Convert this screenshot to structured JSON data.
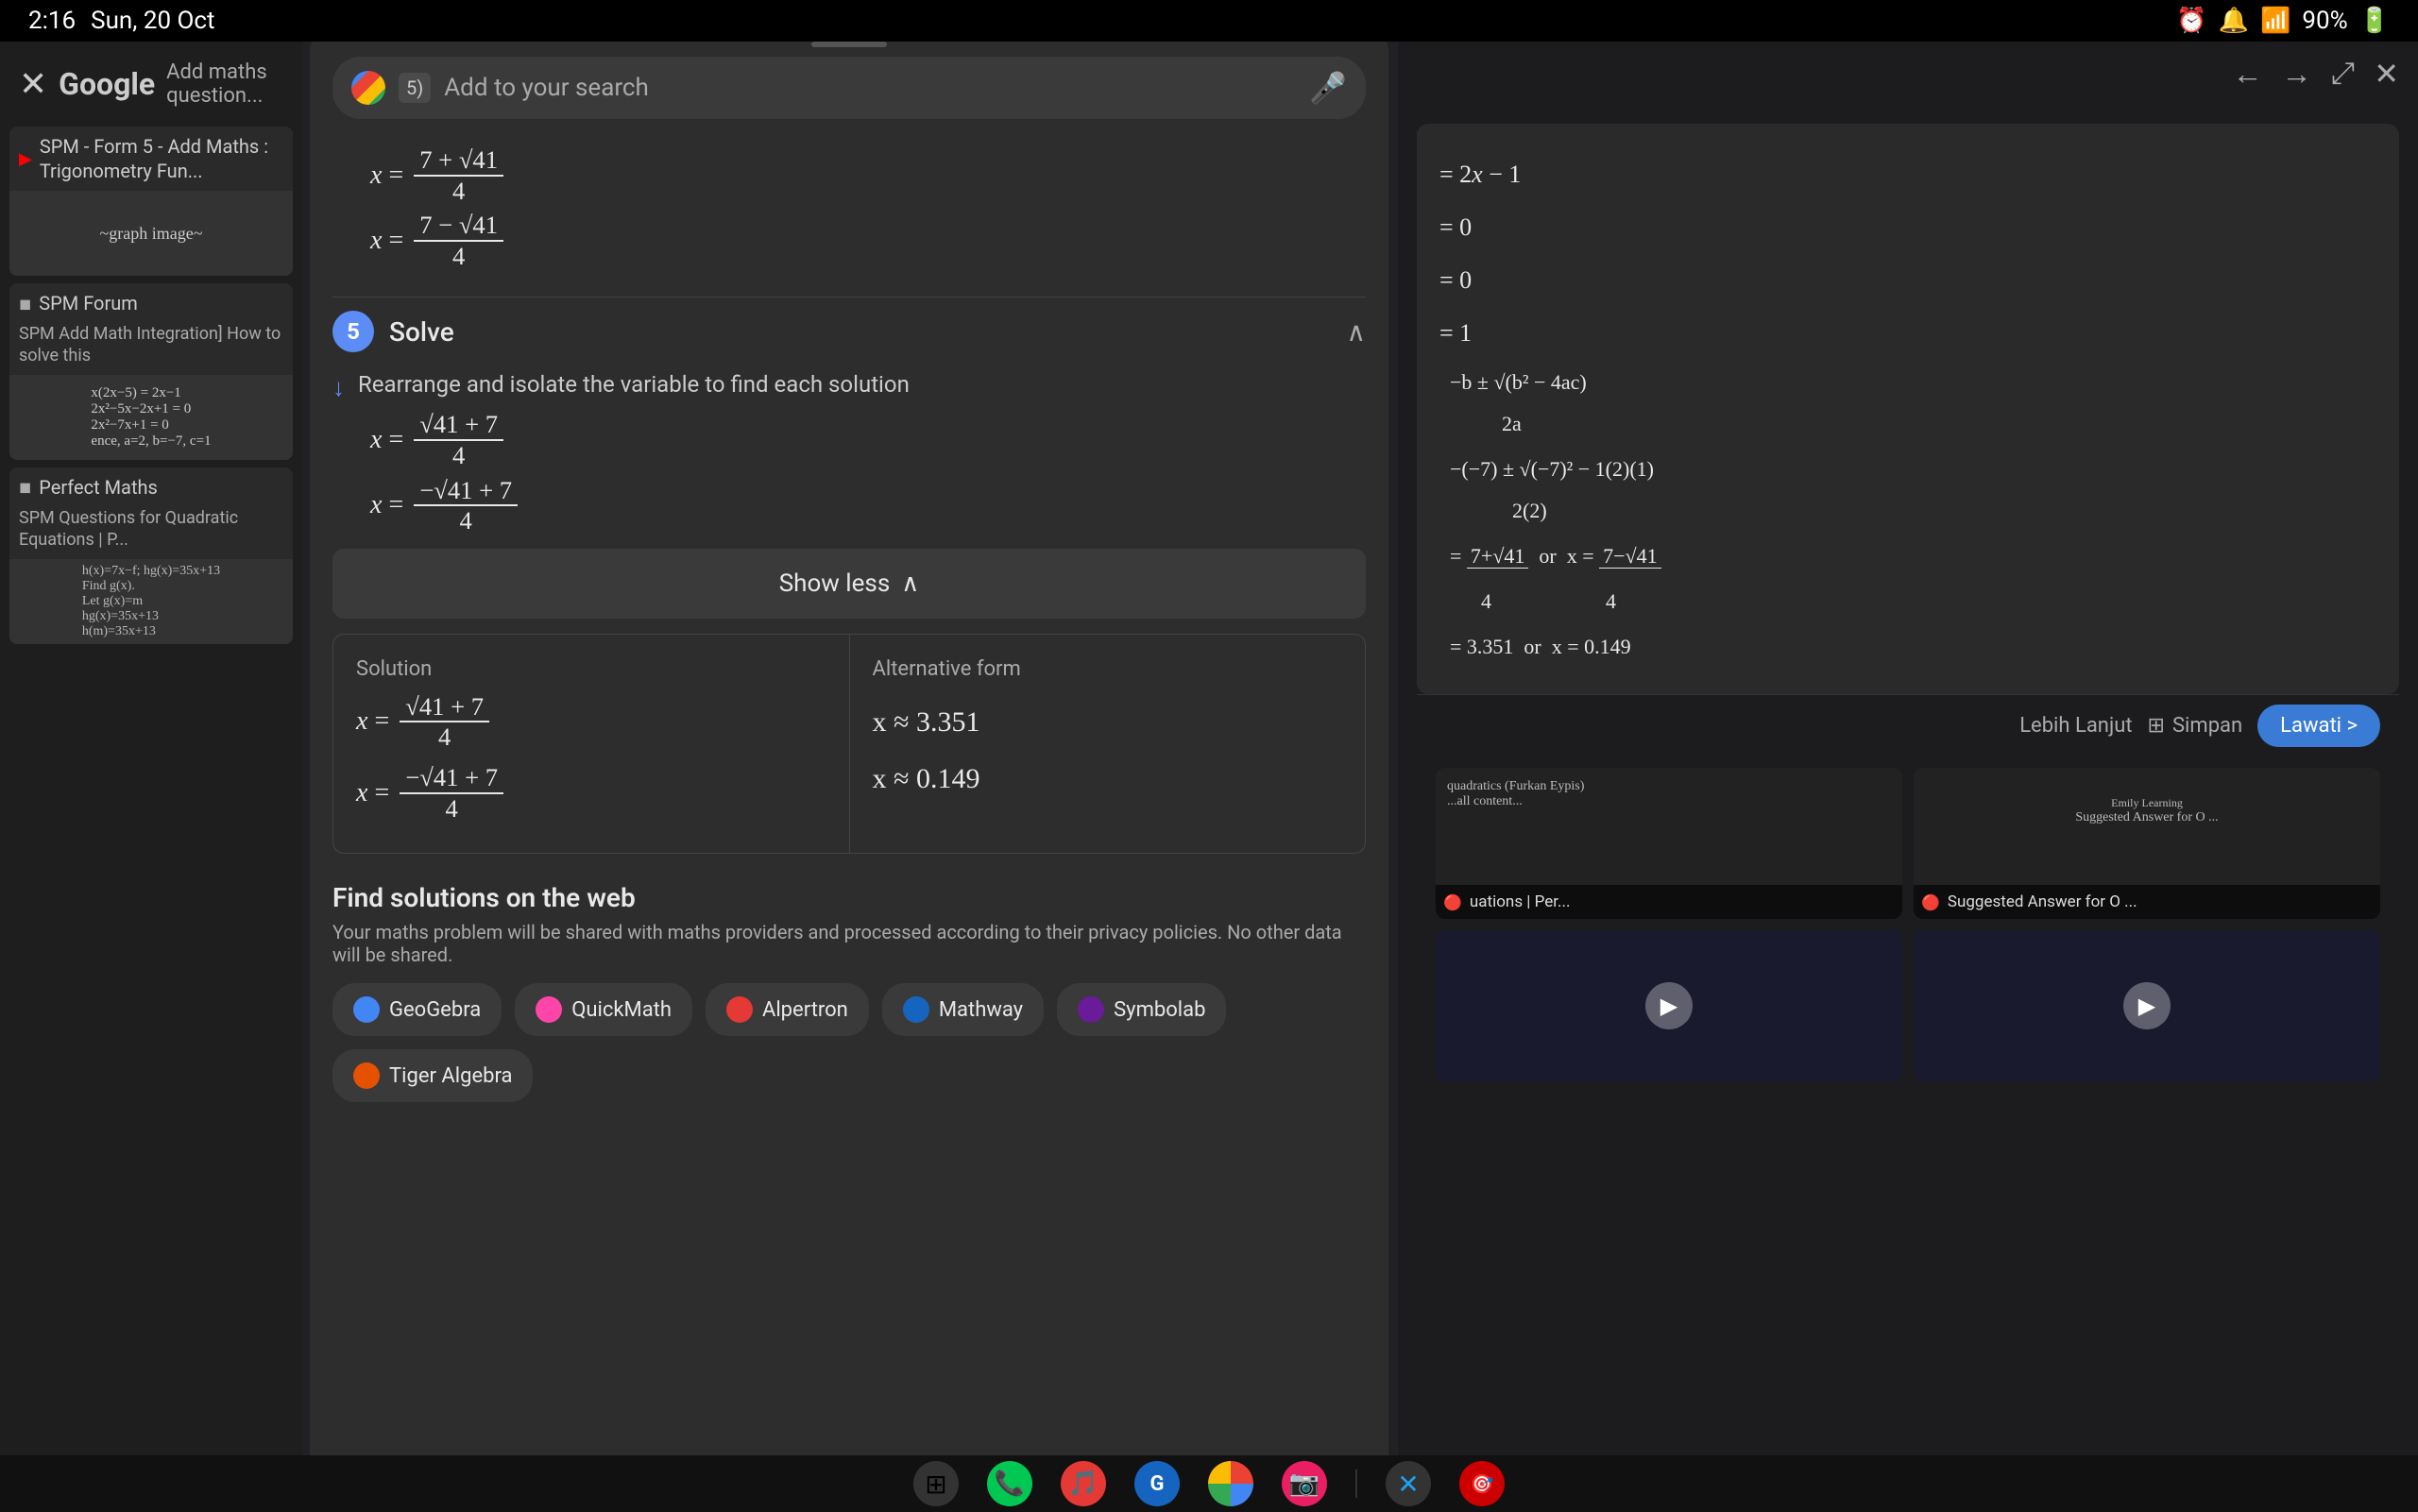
{
  "statusBar": {
    "time": "2:16",
    "date": "Sun, 20 Oct",
    "battery": "90%"
  },
  "searchBar": {
    "placeholder": "Add to your search",
    "lensBadge": "5)"
  },
  "steps": {
    "stepNumber": "5",
    "stepTitle": "Solve",
    "stepDesc": "Rearrange and isolate the variable to find each solution",
    "showLessLabel": "Show less"
  },
  "solution": {
    "solutionLabel": "Solution",
    "altFormLabel": "Alternative form",
    "eq1_left": "x =",
    "eq1_num": "√41 + 7",
    "eq1_den": "4",
    "eq2_left": "x =",
    "eq2_num": "−√41 + 7",
    "eq2_den": "4",
    "alt1": "x ≈ 3.351",
    "alt2": "x ≈ 0.149"
  },
  "webSection": {
    "title": "Find solutions on the web",
    "desc": "Your maths problem will be shared with maths providers and processed according to their privacy policies. No other data will be shared.",
    "buttons": [
      {
        "label": "GeoGebra",
        "color": "#4285f4"
      },
      {
        "label": "QuickMath",
        "color": "#ff6b8a"
      },
      {
        "label": "Alpertron",
        "color": "#e53935"
      },
      {
        "label": "Mathway",
        "color": "#1565c0"
      },
      {
        "label": "Symbolab",
        "color": "#6a1b9a"
      },
      {
        "label": "Tiger Algebra",
        "color": "#e65100"
      }
    ]
  },
  "equations": {
    "top1_left": "x =",
    "top1_num": "7 + √41",
    "top1_den": "4",
    "top2_left": "x =",
    "top2_num": "7 − √41",
    "top2_den": "4",
    "step5_1_left": "x =",
    "step5_1_num": "√41 + 7",
    "step5_1_den": "4",
    "step5_2_left": "x =",
    "step5_2_num": "−√41 + 7",
    "step5_2_den": "4"
  },
  "rightPanel": {
    "mathLines": [
      "= 2x − 1",
      "= 0",
      "= 0",
      "= 1",
      "−b ± √(b² − 4ac)",
      "2a",
      "−(−7) ± √(−7)² − 1(2)(1)",
      "2(2)",
      "7+√41   or   x = 7−√41",
      "4              4",
      "= 3.351   or   x = 0.149"
    ],
    "moreLabel": "Lebih Lanjut",
    "saveLabel": "Simpan",
    "visitLabel": "Lawati >",
    "sourceLabels": [
      {
        "source": "Perfect Maths",
        "title": "uations | Per..."
      },
      {
        "source": "Emily Learning",
        "title": "Suggested Answer for O ..."
      }
    ]
  },
  "bottomNav": {
    "icons": [
      "⊞",
      "📞",
      "🎵",
      "G",
      "◉",
      "📷",
      "✕",
      "🎯"
    ]
  }
}
